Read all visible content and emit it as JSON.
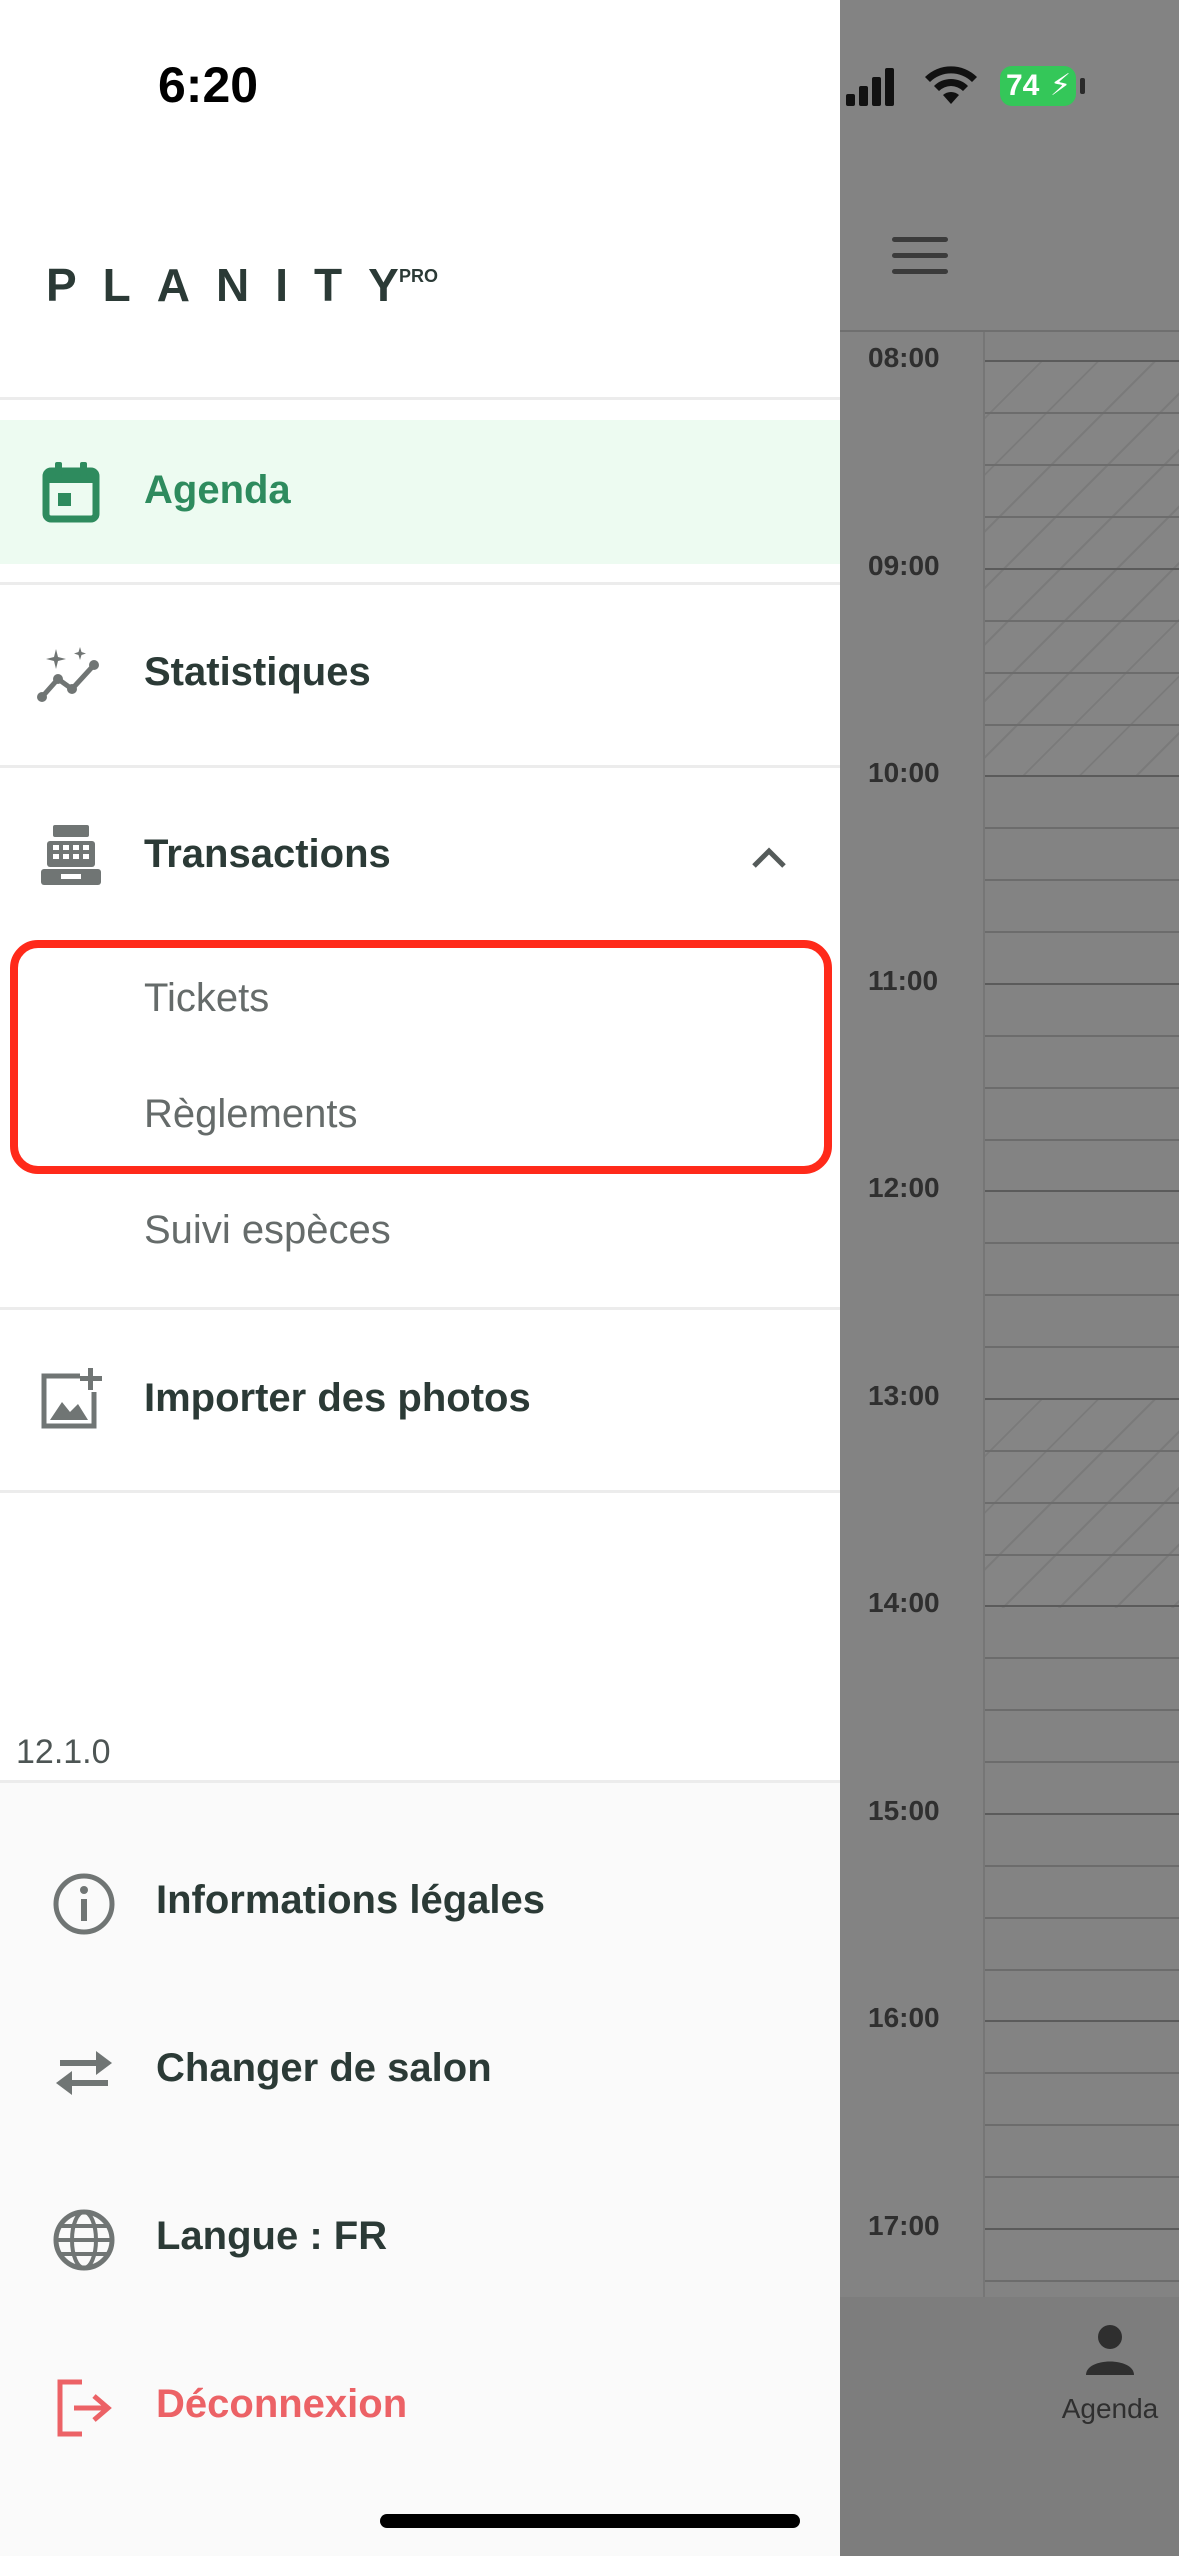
{
  "status_bar": {
    "time": "6:20",
    "battery": "74"
  },
  "logo": {
    "text": "PLANITY",
    "sup": "PRO"
  },
  "menu": {
    "agenda": "Agenda",
    "statistiques": "Statistiques",
    "transactions": "Transactions",
    "transactions_sub": [
      "Tickets",
      "Règlements",
      "Suivi espèces"
    ],
    "importer": "Importer des photos"
  },
  "version": "12.1.0",
  "footer": {
    "legal": "Informations légales",
    "change_salon": "Changer de salon",
    "language": "Langue : FR",
    "logout": "Déconnexion"
  },
  "background": {
    "times": [
      "08:00",
      "09:00",
      "10:00",
      "11:00",
      "12:00",
      "13:00",
      "14:00",
      "15:00",
      "16:00",
      "17:00"
    ],
    "tab_label": "Agenda"
  },
  "colors": {
    "accent": "#2e8b5e",
    "accent_bg": "#edfbf1",
    "logout": "#ec6266",
    "highlight": "#ff2a1a"
  }
}
